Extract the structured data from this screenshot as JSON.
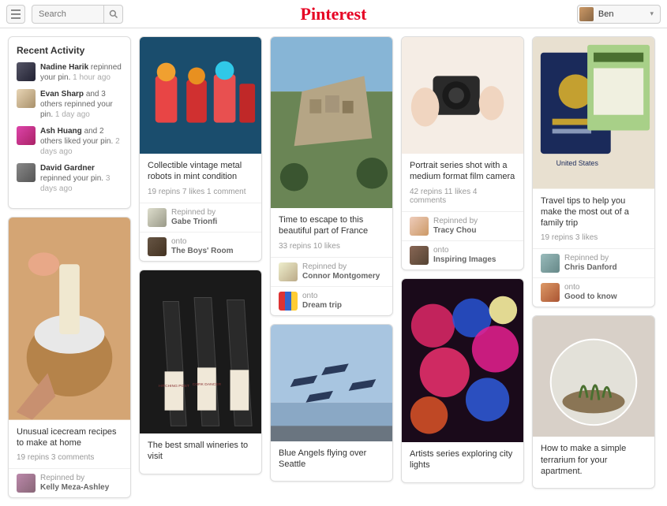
{
  "header": {
    "search_placeholder": "Search",
    "logo": "Pinterest",
    "user_name": "Ben"
  },
  "activity": {
    "heading": "Recent Activity",
    "items": [
      {
        "name": "Nadine Harik",
        "action": "repinned your pin.",
        "time": "1 hour ago"
      },
      {
        "name": "Evan Sharp",
        "action": "and 3 others repinned your pin.",
        "time": "1 day ago"
      },
      {
        "name": "Ash Huang",
        "action": "and 2 others liked your pin.",
        "time": "2 days ago"
      },
      {
        "name": "David Gardner",
        "action": "repinned your pin.",
        "time": "3 days ago"
      }
    ]
  },
  "pins": {
    "icecream": {
      "title": "Unusual icecream recipes to make at home",
      "stats": "19 repins   3 comments",
      "repinned_by": "Kelly Meza-Ashley",
      "repinned_label": "Repinned by"
    },
    "robots": {
      "title": "Collectible vintage metal robots in mint condition",
      "stats": "19 repins   7 likes   1 comment",
      "repinned_by": "Gabe Trionfi",
      "repinned_label": "Repinned by",
      "onto_label": "onto",
      "onto": "The Boys' Room"
    },
    "wineries": {
      "title": "The best small wineries to visit"
    },
    "france": {
      "title": "Time to escape to this beautiful part of France",
      "stats": "33 repins   10 likes",
      "repinned_by": "Connor Montgomery",
      "repinned_label": "Repinned by",
      "onto_label": "onto",
      "onto": "Dream trip"
    },
    "blueangels": {
      "title": "Blue Angels flying over Seattle"
    },
    "portrait": {
      "title": "Portrait series shot with a medium format film camera",
      "stats": "42 repins   11 likes   4 comments",
      "repinned_by": "Tracy Chou",
      "repinned_label": "Repinned by",
      "onto_label": "onto",
      "onto": "Inspiring Images"
    },
    "lights": {
      "title": "Artists series exploring city lights"
    },
    "travel": {
      "title": "Travel tips to help you make the most out of a family trip",
      "stats": "19 repins   3 likes",
      "repinned_by": "Chris Danford",
      "repinned_label": "Repinned by",
      "onto_label": "onto",
      "onto": "Good to know"
    },
    "terrarium": {
      "title": "How to make a simple terrarium for your apartment."
    }
  }
}
